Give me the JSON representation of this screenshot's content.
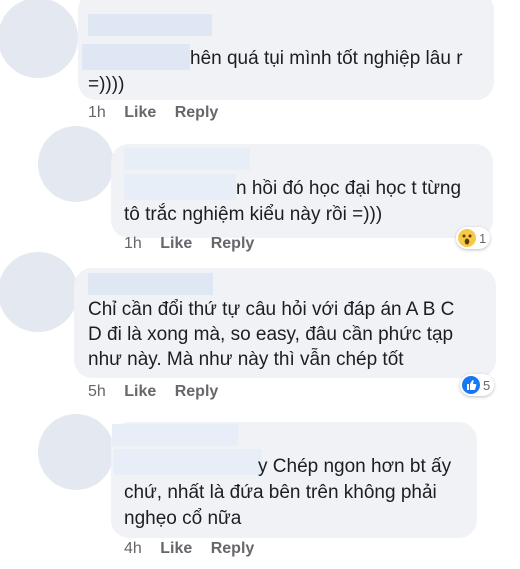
{
  "comments": [
    {
      "lines": [
        "hên quá tụi mình tốt nghiệp lâu r",
        "=))))"
      ],
      "time": "1h",
      "like": "Like",
      "reply": "Reply"
    },
    {
      "lines": [
        "n hồi đó học đại học t từng",
        "tô trắc nghiệm kiểu này rồi =)))"
      ],
      "time": "1h",
      "like": "Like",
      "reply": "Reply",
      "reaction": {
        "icon": "wow-reaction-icon",
        "count": "1",
        "color": "#f7c948"
      }
    },
    {
      "lines": [
        "Chỉ cần đổi thứ tự câu hỏi với đáp án  A B C",
        "D đi là xong mà, so easy, đâu cần phức tạp",
        "như này. Mà như này thì vẫn chép tốt"
      ],
      "time": "5h",
      "like": "Like",
      "reply": "Reply",
      "reaction": {
        "icon": "like-reaction-icon",
        "count": "5",
        "color": "#1877f2"
      }
    },
    {
      "lines": [
        "y  Chép ngon hơn bt ấy",
        "chứ, nhất là đứa bên trên không phải",
        "nghẹo cổ nữa"
      ],
      "time": "4h",
      "like": "Like",
      "reply": "Reply"
    }
  ]
}
